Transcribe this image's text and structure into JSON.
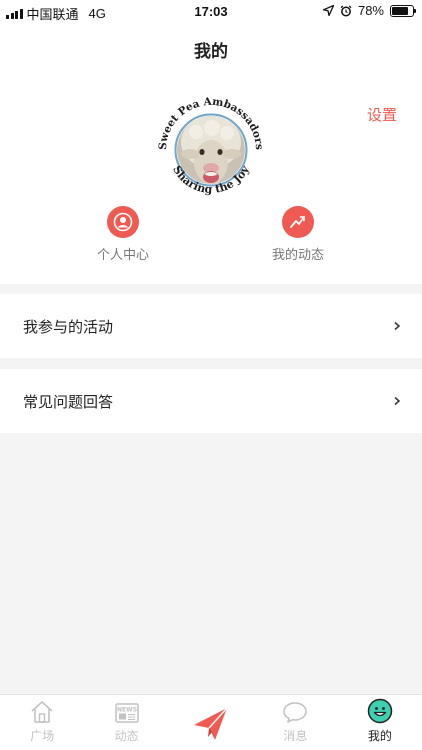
{
  "status": {
    "carrier": "中国联通",
    "network": "4G",
    "time": "17:03",
    "battery": "78%",
    "battery_level": 0.78
  },
  "header": {
    "title": "我的",
    "settings_label": "设置"
  },
  "avatar": {
    "top_text": "Sweet Pea Ambassadors",
    "bottom_text": "Sharing the Joy"
  },
  "quick_actions": [
    {
      "label": "个人中心",
      "icon": "person-icon"
    },
    {
      "label": "我的动态",
      "icon": "trend-icon"
    }
  ],
  "menu": [
    {
      "label": "我参与的活动"
    },
    {
      "label": "常见问题回答"
    }
  ],
  "tabs": [
    {
      "label": "广场",
      "icon": "house-icon"
    },
    {
      "label": "动态",
      "icon": "news-icon"
    },
    {
      "label": "",
      "icon": "paper-plane-icon"
    },
    {
      "label": "消息",
      "icon": "chat-bubble-icon"
    },
    {
      "label": "我的",
      "icon": "smiley-icon"
    }
  ],
  "colors": {
    "accent": "#ef5a52",
    "active_tab_face": "#3ecfb0"
  }
}
